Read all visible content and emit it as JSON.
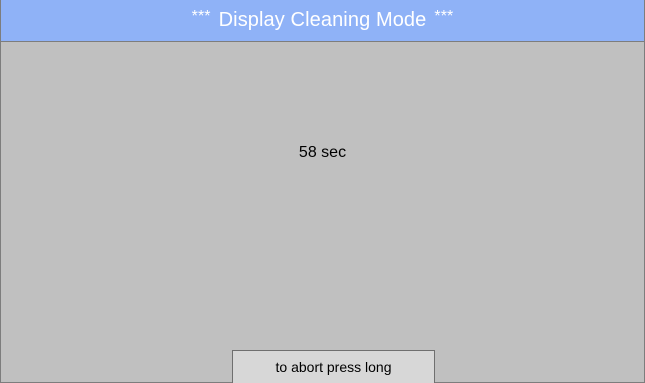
{
  "header": {
    "stars_left": "***",
    "title": "Display Cleaning Mode",
    "stars_right": "***"
  },
  "main": {
    "countdown": "58 sec"
  },
  "footer": {
    "abort_label": "to abort press long"
  },
  "colors": {
    "title_bar": "#8fb2f7",
    "background": "#c0c0c0",
    "button": "#d7d7d7"
  }
}
